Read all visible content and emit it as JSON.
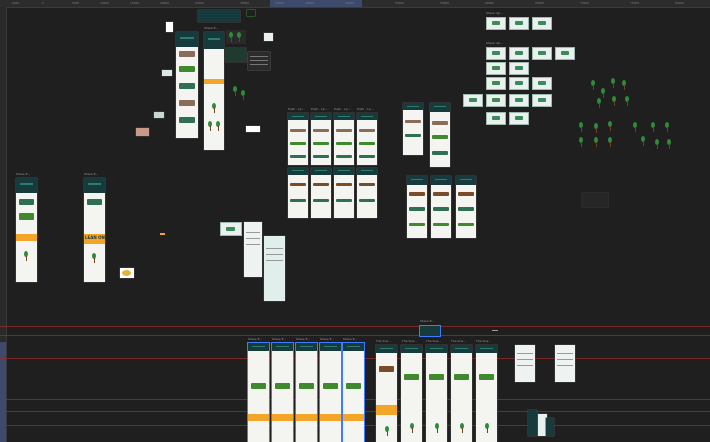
{
  "ruler": {
    "ticks": [
      "-5000",
      "0",
      "5000",
      "10000",
      "15000",
      "20000",
      "25000",
      "30000",
      "35000",
      "40000",
      "45000",
      "50000",
      "55000",
      "60000",
      "65000",
      "70000",
      "75000",
      "80000"
    ]
  },
  "frame_labels": {
    "f_left_a": "Share E...",
    "f_left_b": "Share E...",
    "f_mid_top": "Share E...",
    "f_push": [
      "Push - Lp...",
      "Push - Lp...",
      "Push - Lp...",
      "Push - Lp..."
    ],
    "f_grid_a": "Share Up...",
    "f_grid_b": "Share Up...",
    "f_bottom": [
      "Share E...",
      "Share E...",
      "Share E...",
      "Share E...",
      "Share E...",
      "The Sna...",
      "The Sna...",
      "The Sna...",
      "The Sna...",
      "The Sna..."
    ],
    "f_center": "Share E..."
  },
  "banner_text": "LEAN ON",
  "colors": {
    "canvas_bg": "#1f1f1f",
    "brand_dark": "#173a3c",
    "brand_green": "#2e7d6b",
    "accent_orange": "#f3a52a",
    "selection": "#3e7bff",
    "guide_red": "#9a2b2b"
  }
}
